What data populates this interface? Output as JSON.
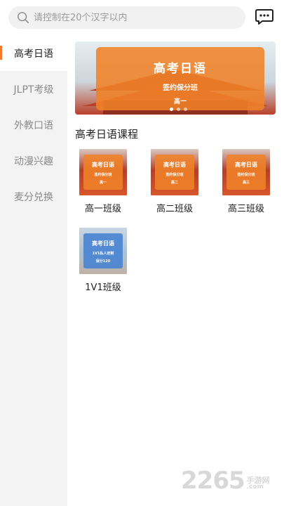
{
  "search": {
    "placeholder": "请控制在20个汉字以内"
  },
  "sidebar": {
    "items": [
      {
        "label": "高考日语",
        "active": true
      },
      {
        "label": "JLPT考级",
        "active": false
      },
      {
        "label": "外教口语",
        "active": false
      },
      {
        "label": "动漫兴趣",
        "active": false
      },
      {
        "label": "麦分兑换",
        "active": false
      }
    ]
  },
  "banner": {
    "title": "高考日语",
    "subtitle": "签约保分班",
    "grade": "高一",
    "slides": 3,
    "current": 1
  },
  "section": {
    "title": "高考日语课程"
  },
  "courses": [
    {
      "label": "高一班级",
      "thumb_title": "高考日语",
      "thumb_sub": "签约保分班",
      "thumb_grade": "高一"
    },
    {
      "label": "高二班级",
      "thumb_title": "高考日语",
      "thumb_sub": "签约保分班",
      "thumb_grade": "高二"
    },
    {
      "label": "高三班级",
      "thumb_title": "高考日语",
      "thumb_sub": "签约保分班",
      "thumb_grade": "高三"
    },
    {
      "label": "1V1班级",
      "thumb_title": "高考日语",
      "thumb_sub": "1V1私人定制",
      "thumb_grade": "保分120"
    }
  ],
  "watermark": {
    "number": "2265",
    "site_cn": "手游网",
    "site_en": ".com"
  },
  "colors": {
    "accent": "#f47a2a",
    "card_orange": "#f08228",
    "card_blue": "#4682d2",
    "sidebar_bg": "#f3f3f3"
  },
  "icons": {
    "search": "search-icon",
    "message": "message-icon"
  }
}
